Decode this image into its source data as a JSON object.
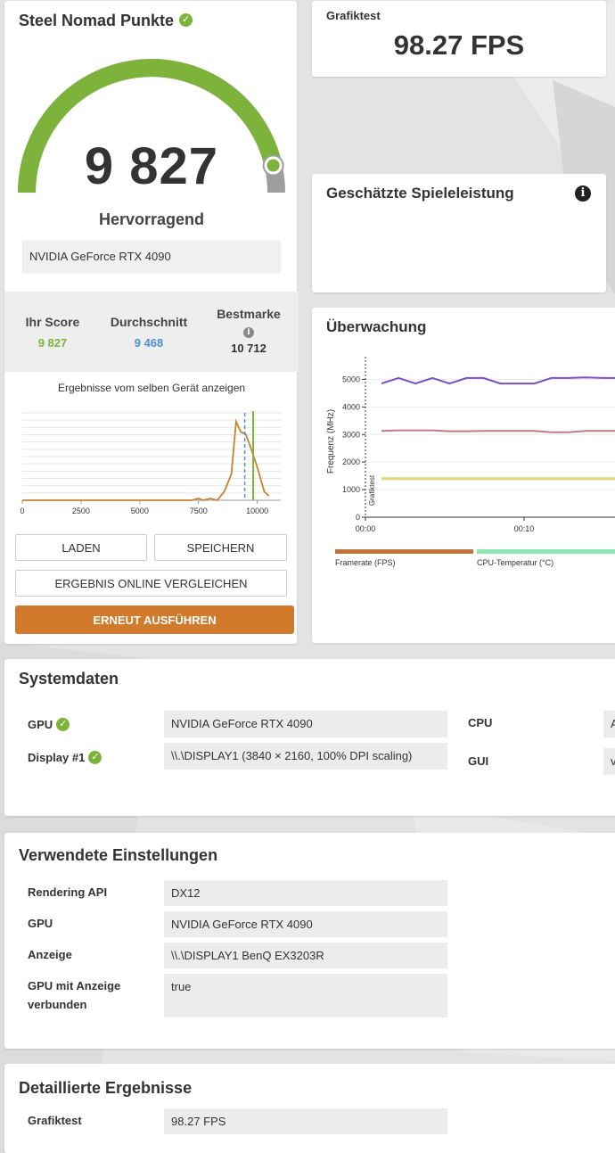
{
  "score_card": {
    "title": "Steel Nomad Punkte",
    "score": "9 827",
    "rating": "Hervorragend",
    "gpu": "NVIDIA GeForce RTX 4090",
    "gauge_fraction": 0.93,
    "stats": {
      "your_label": "Ihr Score",
      "your_value": "9 827",
      "avg_label": "Durchschnitt",
      "avg_value": "9 468",
      "best_label": "Bestmarke",
      "best_value": "10 712"
    },
    "histogram_label": "Ergebnisse vom selben Gerät anzeigen",
    "buttons": {
      "load": "LADEN",
      "save": "SPEICHERN",
      "compare": "ERGEBNIS ONLINE VERGLEICHEN",
      "rerun": "ERNEUT AUSFÜHREN"
    }
  },
  "histogram": {
    "x_ticks": [
      "0",
      "2500",
      "5000",
      "7500",
      "10000"
    ],
    "xlim": [
      0,
      11000
    ],
    "points": [
      [
        0,
        0
      ],
      [
        7200,
        0
      ],
      [
        7500,
        0.02
      ],
      [
        7700,
        0
      ],
      [
        8000,
        0.02
      ],
      [
        8300,
        0
      ],
      [
        8600,
        0.1
      ],
      [
        8900,
        0.3
      ],
      [
        9100,
        0.9
      ],
      [
        9300,
        0.78
      ],
      [
        9500,
        0.76
      ],
      [
        9700,
        0.62
      ],
      [
        10000,
        0.38
      ],
      [
        10300,
        0.1
      ],
      [
        10500,
        0.05
      ]
    ],
    "your_score": 9827,
    "average": 9468
  },
  "graphics_test": {
    "label": "Grafiktest",
    "value": "98.27 FPS"
  },
  "estimated": {
    "title": "Geschätzte Spieleleistung",
    "info_icon": "info-icon"
  },
  "monitoring": {
    "title": "Überwachung",
    "y_axis_label": "Frequenz (MHz)",
    "y_ticks": [
      "0",
      "1000",
      "2000",
      "3000",
      "4000",
      "5000"
    ],
    "x_ticks": [
      "00:00",
      "00:10"
    ],
    "marker_label": "Grafiktest",
    "series": [
      {
        "color": "#7b4fc4",
        "values": [
          4850,
          5050,
          4850,
          5050,
          4850,
          5050,
          5050,
          4850,
          4850,
          4850,
          5050,
          5050,
          5070,
          5050,
          5050
        ]
      },
      {
        "color": "#c07a8a",
        "values": [
          3130,
          3150,
          3150,
          3150,
          3120,
          3120,
          3130,
          3130,
          3130,
          3130,
          3080,
          3080,
          3130,
          3130,
          3130
        ]
      },
      {
        "color": "#e6d47a",
        "values": [
          1400,
          1400,
          1400,
          1400,
          1400,
          1400,
          1400,
          1400,
          1400,
          1400,
          1400,
          1400,
          1400,
          1400,
          1400
        ]
      }
    ],
    "legend": [
      {
        "label": "Framerate (FPS)",
        "color": "#c0743a"
      },
      {
        "label": "CPU-Temperatur (°C)",
        "color": "#8fe6b0"
      }
    ]
  },
  "system": {
    "title": "Systemdaten",
    "gpu_label": "GPU",
    "gpu_value": "NVIDIA GeForce RTX 4090",
    "display_label": "Display #1",
    "display_value": "\\\\.\\DISPLAY1 (3840 × 2160, 100% DPI scaling)",
    "cpu_label": "CPU",
    "cpu_value": "A",
    "gui_label": "GUI",
    "gui_value": "v"
  },
  "settings": {
    "title": "Verwendete Einstellungen",
    "rows": [
      {
        "label": "Rendering API",
        "value": "DX12"
      },
      {
        "label": "GPU",
        "value": "NVIDIA GeForce RTX 4090"
      },
      {
        "label": "Anzeige",
        "value": "\\\\.\\DISPLAY1 BenQ EX3203R"
      },
      {
        "label": "GPU mit Anzeige verbunden",
        "value": "true"
      }
    ]
  },
  "details": {
    "title": "Detaillierte Ergebnisse",
    "label": "Grafiktest",
    "value": "98.27 FPS"
  },
  "colors": {
    "accent_green": "#7db33a",
    "average_blue": "#4a8fd4",
    "orange": "#d27a2c"
  }
}
